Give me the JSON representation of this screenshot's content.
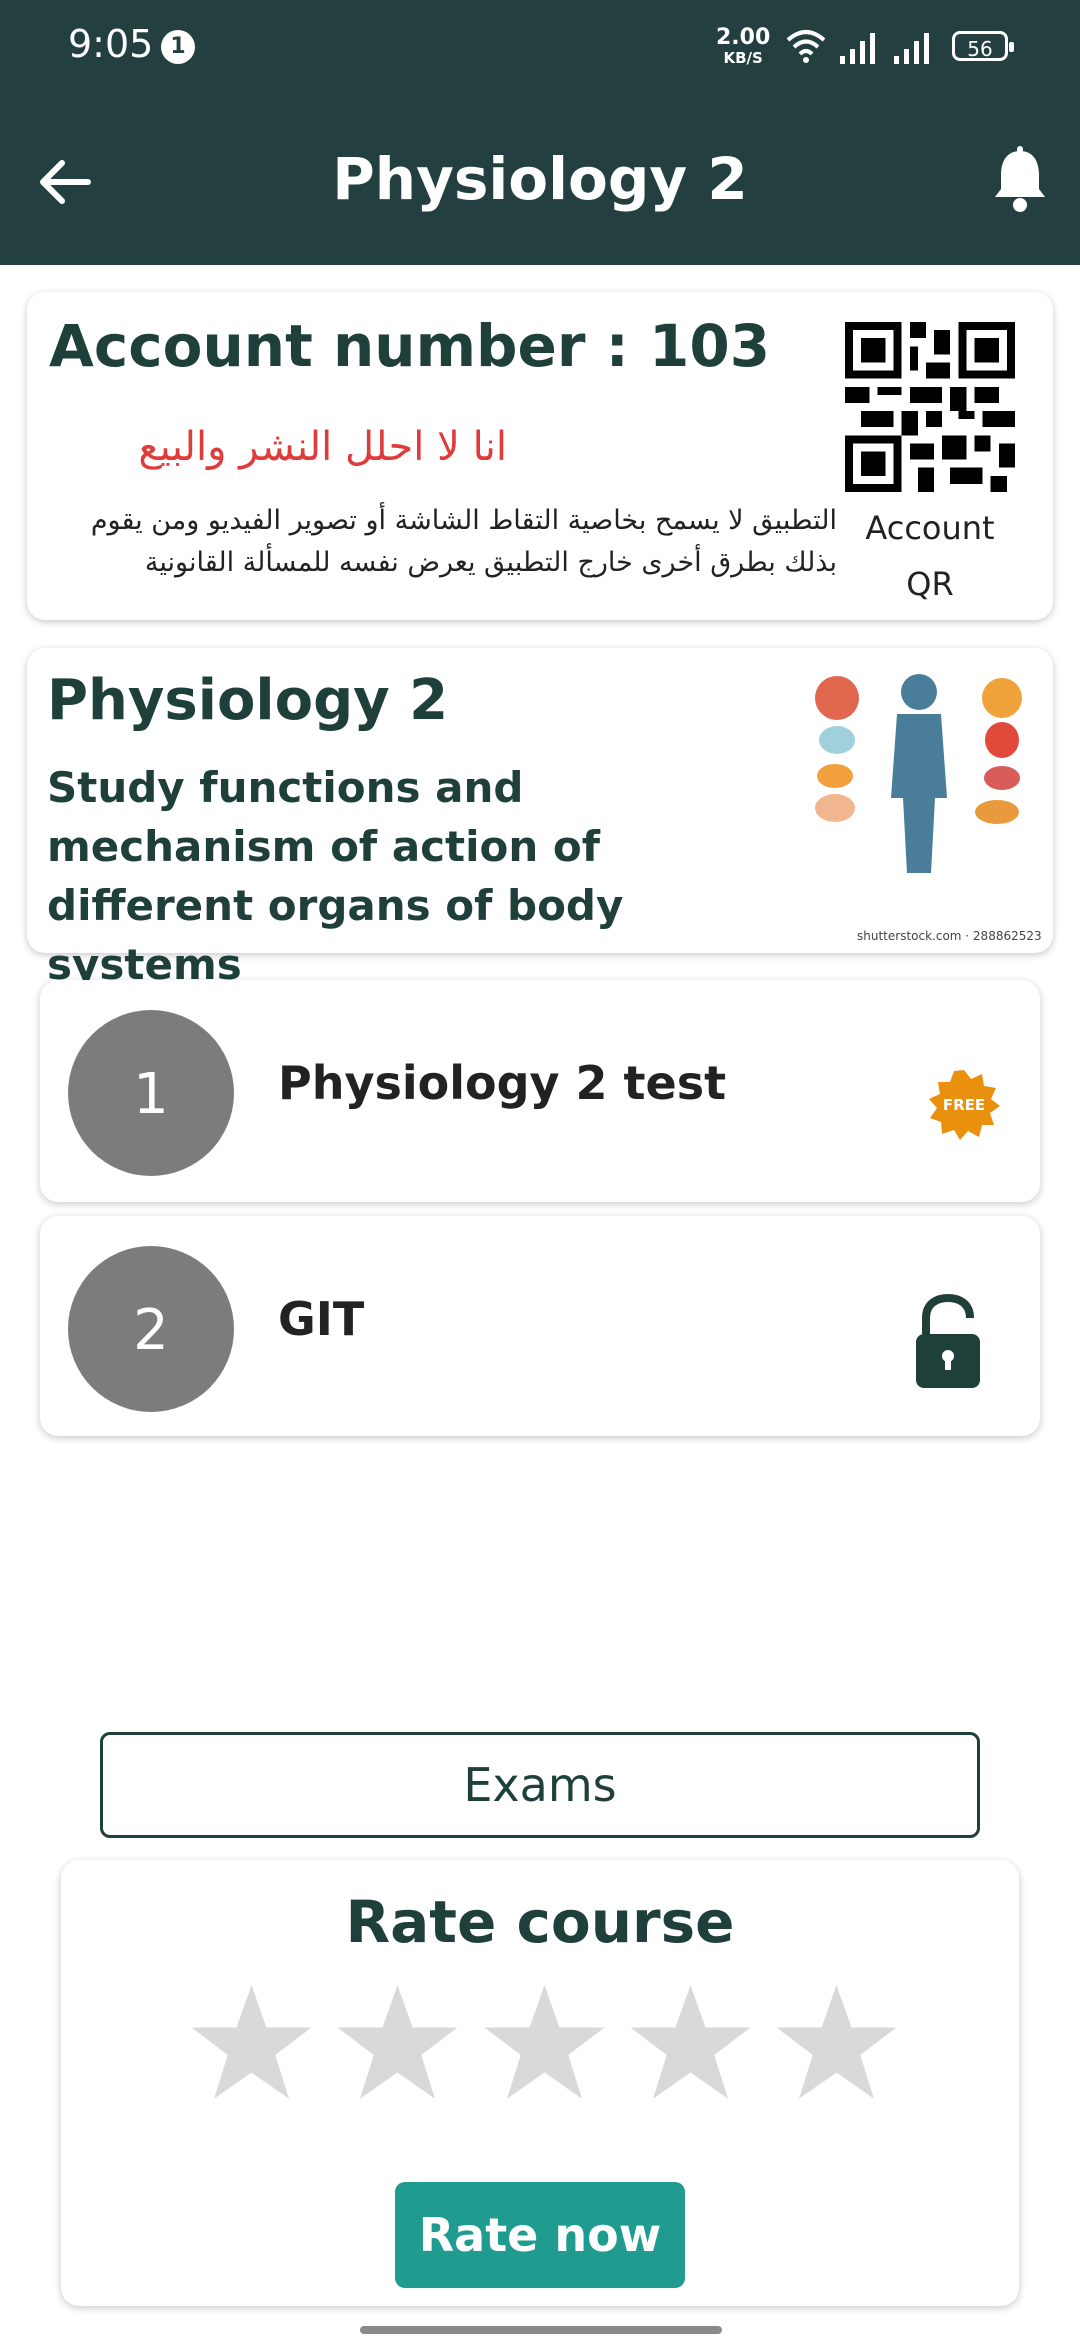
{
  "status_bar": {
    "time": "9:05",
    "notification_count": "1",
    "net_speed": "2.00",
    "net_unit": "KB/S",
    "battery": "56"
  },
  "app_bar": {
    "title": "Physiology 2",
    "back_icon": "arrow-left-icon",
    "bell_icon": "bell-icon"
  },
  "account": {
    "title": "Account number : 103",
    "warning": "انا لا احلل النشر والبيع",
    "note": "التطبيق لا يسمح بخاصية التقاط الشاشة أو تصوير الفيديو ومن يقوم بذلك بطرق أخرى خارج التطبيق يعرض نفسه للمسألة القانونية",
    "qr_label": "Account QR"
  },
  "course": {
    "title": "Physiology 2",
    "description": "Study functions and mechanism of action of different organs of body systems",
    "image_caption": "shutterstock.com · 288862523"
  },
  "lessons": [
    {
      "number": "1",
      "title": "Physiology 2 test",
      "badge": "FREE"
    },
    {
      "number": "2",
      "title": "GIT",
      "badge_icon": "lock-icon"
    }
  ],
  "exams_button": "Exams",
  "rating": {
    "title": "Rate course",
    "stars": 0,
    "max_stars": 5,
    "button": "Rate now"
  },
  "colors": {
    "primary": "#233f3f",
    "accent": "#1f9c8f",
    "warning_red": "#e03b3b",
    "free_badge": "#e9900f",
    "star_empty": "#d9d9d9"
  }
}
